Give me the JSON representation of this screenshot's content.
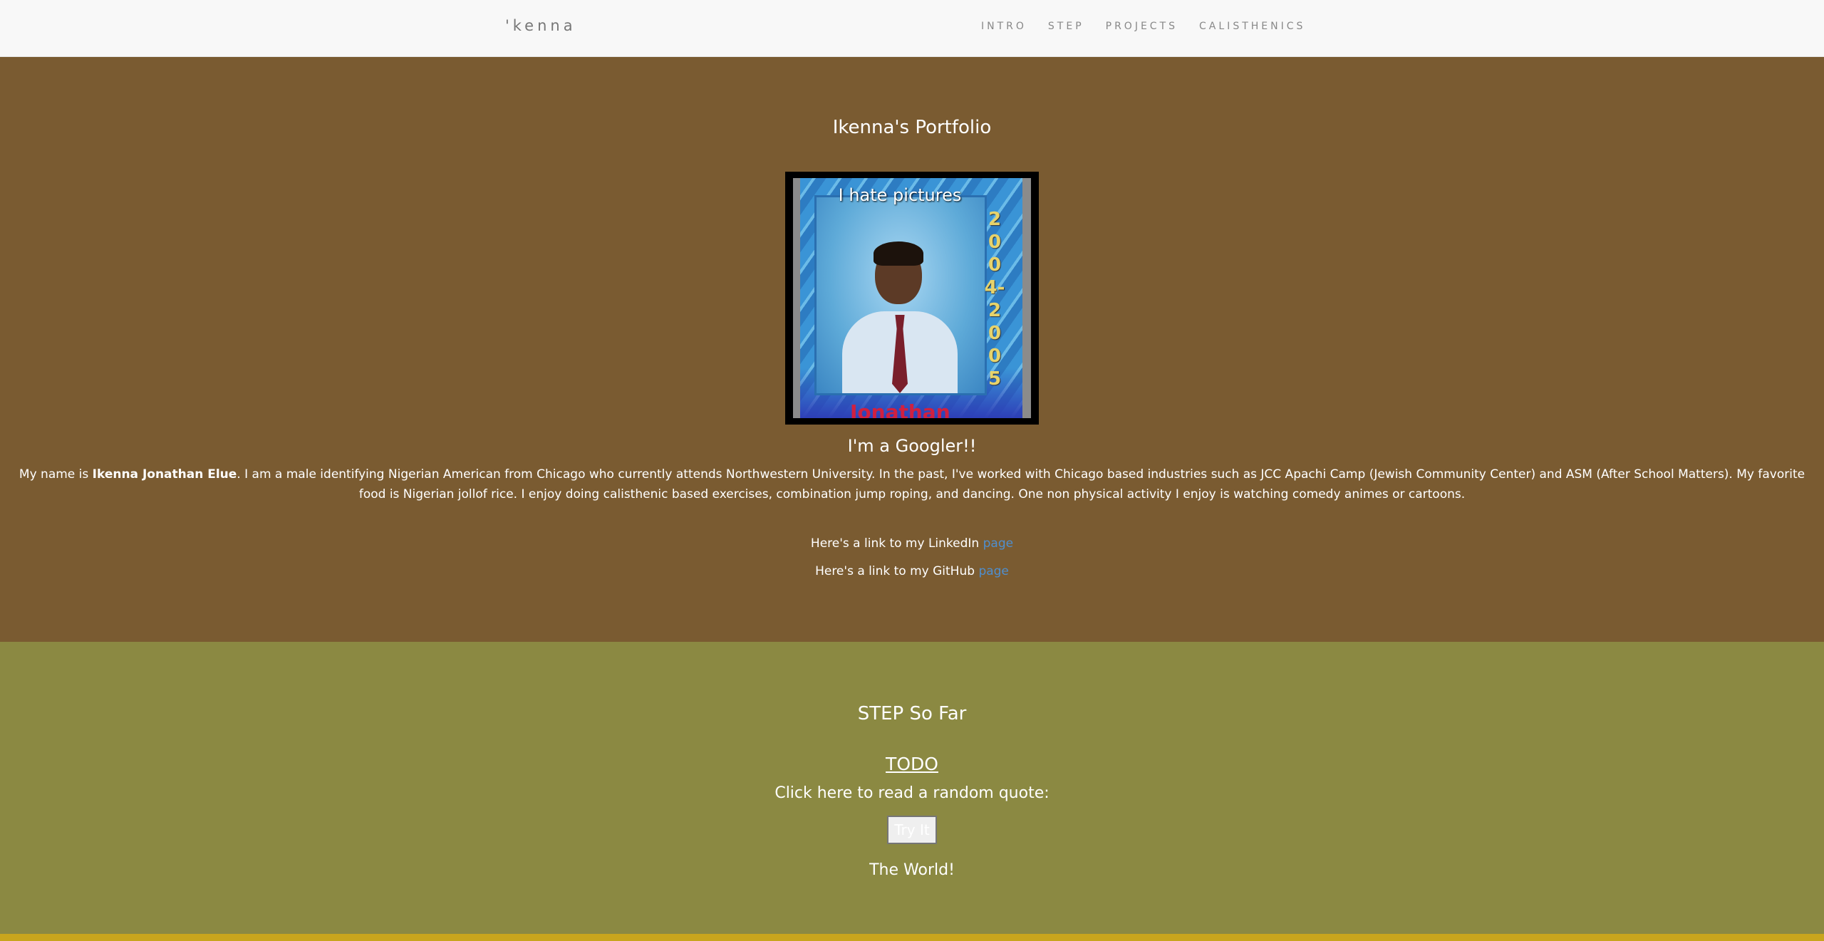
{
  "navbar": {
    "brand": "'kenna",
    "links": [
      "INTRO",
      "STEP",
      "PROJECTS",
      "CALISTHENICS"
    ]
  },
  "intro": {
    "title": "Ikenna's Portfolio",
    "photo": {
      "caption": "I hate pictures",
      "years": "2004-2005",
      "name": "Jonathan"
    },
    "subtitle": "I'm a Googler!!",
    "bio_prefix": "My name is ",
    "bio_name": "Ikenna Jonathan Elue",
    "bio_rest": ". I am a male identifying Nigerian American from Chicago who currently attends Northwestern University. In the past, I've worked with Chicago based industries such as JCC Apachi Camp (Jewish Community Center) and ASM (After School Matters). My favorite food is Nigerian jollof rice. I enjoy doing calisthenic based exercises, combination jump roping, and dancing. One non physical activity I enjoy is watching comedy animes or cartoons.",
    "linkedin_text": "Here's a link to my LinkedIn ",
    "linkedin_link": "page",
    "github_text": "Here's a link to my GitHub ",
    "github_link": "page"
  },
  "step": {
    "title": "STEP So Far",
    "todo_link": "TODO",
    "quote_prompt": "Click here to read a random quote:",
    "button_label": "Try It",
    "quote_output": "The World!"
  },
  "colors": {
    "navbar_bg": "#f8f8f8",
    "intro_bg": "#7a5b31",
    "step_bg": "#8b8942",
    "footer_strip": "#c8a51d",
    "link": "#4f8fcf"
  }
}
